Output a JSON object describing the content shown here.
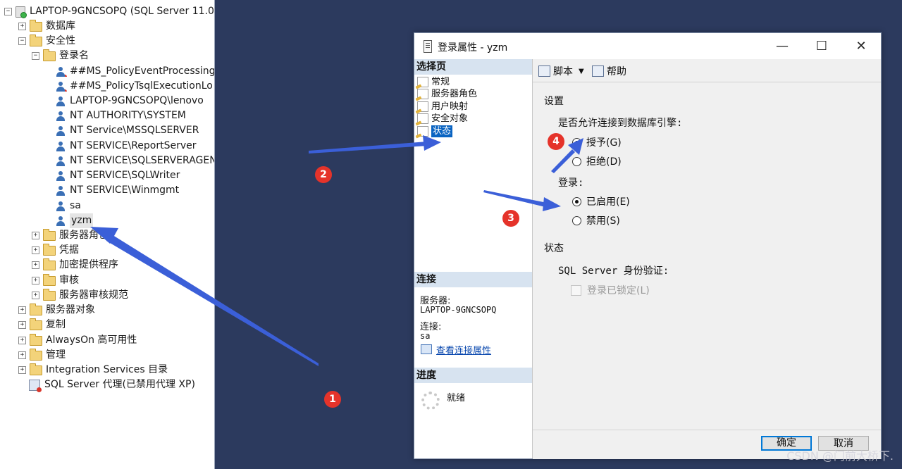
{
  "explorer": {
    "server": "LAPTOP-9GNCSOPQ (SQL Server 11.0",
    "databases": "数据库",
    "security": "安全性",
    "logins": "登录名",
    "login_items": [
      "##MS_PolicyEventProcessing",
      "##MS_PolicyTsqlExecutionLo",
      "LAPTOP-9GNCSOPQ\\lenovo",
      "NT AUTHORITY\\SYSTEM",
      "NT Service\\MSSQLSERVER",
      "NT SERVICE\\ReportServer",
      "NT SERVICE\\SQLSERVERAGEN",
      "NT SERVICE\\SQLWriter",
      "NT SERVICE\\Winmgmt",
      "sa",
      "yzm"
    ],
    "server_roles": "服务器角色",
    "credentials": "凭据",
    "crypto_providers": "加密提供程序",
    "audits": "审核",
    "audit_specs": "服务器审核规范",
    "server_objects": "服务器对象",
    "replication": "复制",
    "alwayson": "AlwaysOn 高可用性",
    "management": "管理",
    "integration": "Integration Services 目录",
    "agent": "SQL Server 代理(已禁用代理 XP)"
  },
  "dialog": {
    "title": "登录属性 - yzm",
    "select_page": "选择页",
    "pages": [
      "常规",
      "服务器角色",
      "用户映射",
      "安全对象",
      "状态"
    ],
    "selected_page": "状态",
    "connection_head": "连接",
    "server_label": "服务器:",
    "server_value": "LAPTOP-9GNCSOPQ",
    "conn_label": "连接:",
    "conn_value": "sa",
    "view_conn": "查看连接属性",
    "progress_head": "进度",
    "progress_status": "就绪",
    "toolbar": {
      "script": "脚本",
      "help": "帮助"
    },
    "settings": {
      "title": "设置",
      "permission_label": "是否允许连接到数据库引擎:",
      "grant": "授予(G)",
      "deny": "拒绝(D)",
      "login_label": "登录:",
      "enabled": "已启用(E)",
      "disabled": "禁用(S)"
    },
    "status": {
      "title": "状态",
      "auth_label": "SQL Server 身份验证:",
      "locked": "登录已锁定(L)"
    },
    "ok": "确定",
    "cancel": "取消"
  },
  "annotations": [
    "1",
    "2",
    "3",
    "4"
  ],
  "watermark": "CSDN @门前大桥下.",
  "colors": {
    "arrow": "#3b5fd8",
    "badge": "#e5332a",
    "selected": "#0a64c2"
  }
}
